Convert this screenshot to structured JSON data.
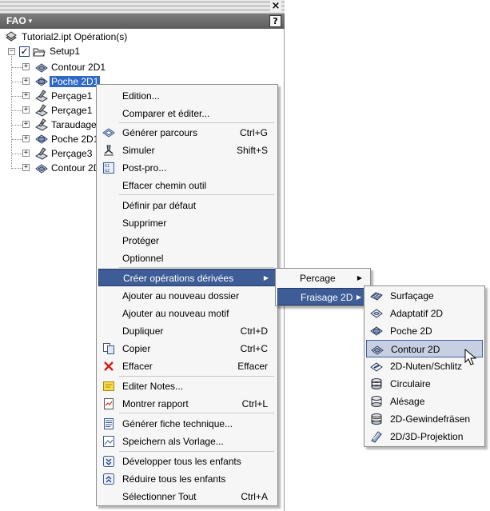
{
  "window": {
    "close_glyph": "×",
    "title": "FAO",
    "title_caret": "▾",
    "help_glyph": "?"
  },
  "tree": {
    "root": "Tutorial2.ipt Opération(s)",
    "setup": "Setup1",
    "items": [
      {
        "label": "Contour 2D1",
        "icon": "contour-icon"
      },
      {
        "label": "Poche 2D1",
        "icon": "pocket-icon",
        "selected": true
      },
      {
        "label": "Perçage1",
        "icon": "drill-icon"
      },
      {
        "label": "Perçage1",
        "icon": "drill-icon"
      },
      {
        "label": "Taraudage",
        "icon": "tap-icon"
      },
      {
        "label": "Poche 2D1",
        "icon": "pocket-icon"
      },
      {
        "label": "Perçage3",
        "icon": "drill-icon"
      },
      {
        "label": "Contour 2D",
        "icon": "contour-icon"
      }
    ]
  },
  "context_menu": {
    "items": [
      {
        "label": "Edition...",
        "shortcut": "",
        "icon": ""
      },
      {
        "label": "Comparer et éditer...",
        "shortcut": "",
        "icon": ""
      },
      {
        "label": "Générer parcours",
        "shortcut": "Ctrl+G",
        "icon": "generate-toolpath-icon"
      },
      {
        "label": "Simuler",
        "shortcut": "Shift+S",
        "icon": "simulate-icon"
      },
      {
        "label": "Post-pro...",
        "shortcut": "",
        "icon": "post-process-icon"
      },
      {
        "label": "Effacer chemin outil",
        "shortcut": "",
        "icon": ""
      },
      {
        "label": "Définir par défaut",
        "shortcut": "",
        "icon": ""
      },
      {
        "label": "Supprimer",
        "shortcut": "",
        "icon": ""
      },
      {
        "label": "Protéger",
        "shortcut": "",
        "icon": ""
      },
      {
        "label": "Optionnel",
        "shortcut": "",
        "icon": ""
      },
      {
        "label": "Créer opérations dérivées",
        "shortcut": "",
        "icon": "",
        "submenu_arrow": "▶"
      },
      {
        "label": "Ajouter au nouveau dossier",
        "shortcut": "",
        "icon": ""
      },
      {
        "label": "Ajouter au nouveau motif",
        "shortcut": "",
        "icon": ""
      },
      {
        "label": "Dupliquer",
        "shortcut": "Ctrl+D",
        "icon": ""
      },
      {
        "label": "Copier",
        "shortcut": "Ctrl+C",
        "icon": "copy-icon"
      },
      {
        "label": "Effacer",
        "shortcut": "Effacer",
        "icon": "delete-x-icon"
      },
      {
        "label": "Editer Notes...",
        "shortcut": "",
        "icon": "note-icon"
      },
      {
        "label": "Montrer rapport",
        "shortcut": "Ctrl+L",
        "icon": "report-icon"
      },
      {
        "label": "Générer fiche technique...",
        "shortcut": "",
        "icon": "setup-sheet-icon"
      },
      {
        "label": "Speichern als Vorlage...",
        "shortcut": "",
        "icon": "template-icon"
      },
      {
        "label": "Développer tous les enfants",
        "shortcut": "",
        "icon": "expand-all-icon"
      },
      {
        "label": "Réduire tous les enfants",
        "shortcut": "",
        "icon": "collapse-all-icon"
      },
      {
        "label": "Sélectionner Tout",
        "shortcut": "Ctrl+A",
        "icon": ""
      }
    ]
  },
  "submenu_1": {
    "items": [
      {
        "label": "Percage",
        "arrow": "▶"
      },
      {
        "label": "Fraisage 2D",
        "arrow": "▶"
      }
    ]
  },
  "submenu_2": {
    "items": [
      {
        "label": "Surfaçage",
        "icon": "facing-icon"
      },
      {
        "label": "Adaptatif 2D",
        "icon": "adaptive-icon"
      },
      {
        "label": "Poche 2D",
        "icon": "pocket-icon"
      },
      {
        "label": "Contour 2D",
        "icon": "contour-icon"
      },
      {
        "label": "2D-Nuten/Schlitz",
        "icon": "slot-icon"
      },
      {
        "label": "Circulaire",
        "icon": "circular-icon"
      },
      {
        "label": "Alésage",
        "icon": "bore-icon"
      },
      {
        "label": "2D-Gewindefräsen",
        "icon": "thread-mill-icon"
      },
      {
        "label": "2D/3D-Projektion",
        "icon": "projection-icon"
      }
    ]
  },
  "colors": {
    "selection": "#3169c6",
    "menu_highlight": "#3e5d97",
    "menu_background": "#f6f6f6",
    "title_bar": "#6b6b6b"
  }
}
